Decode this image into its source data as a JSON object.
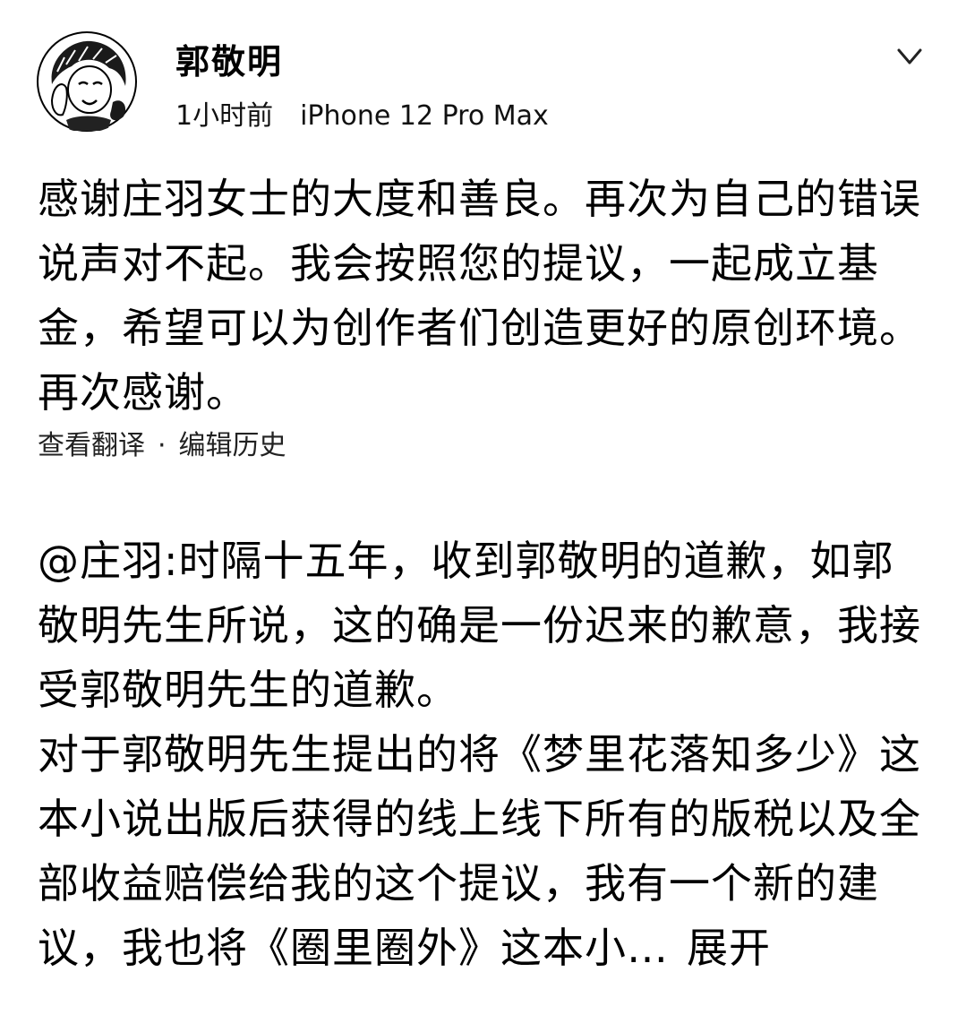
{
  "post": {
    "author": "郭敬明",
    "time": "1小时前",
    "device": "iPhone 12 Pro Max",
    "text": "感谢庄羽女士的大度和善良。再次为自己的错误说声对不起。我会按照您的提议，一起成立基金，希望可以为创作者们创造更好的原创环境。再次感谢。",
    "actions": {
      "translate": "查看翻译",
      "separator": "·",
      "edit_history": "编辑历史"
    }
  },
  "quoted": {
    "text_lines": [
      "@庄羽:时隔十五年，收到郭敬明的道歉，如郭敬明先生所说，这的确是一份迟来的歉意，我接受郭敬明先生的道歉。",
      "对于郭敬明先生提出的将《梦里花落知多少》这本小说出版后获得的线上线下所有的版税以及全部收益赔偿给我的这个提议，我有一个新的建议，我也将《圈里圈外》这本小…"
    ],
    "expand_label": "展开"
  },
  "icons": {
    "more": "chevron-down-icon",
    "avatar": "avatar-image"
  },
  "colors": {
    "text": "#000000",
    "background": "#ffffff"
  }
}
